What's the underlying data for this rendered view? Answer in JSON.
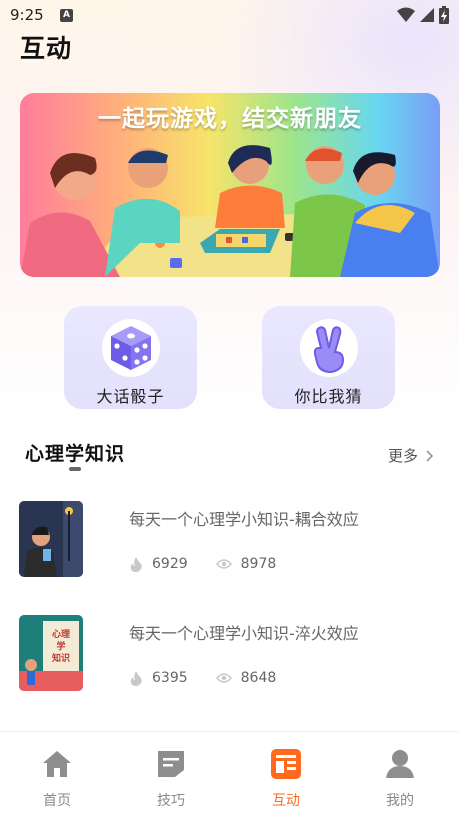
{
  "status_bar": {
    "time": "9:25",
    "notification_icon": "A"
  },
  "header": {
    "title": "互动"
  },
  "banner": {
    "title": "一起玩游戏，结交新朋友"
  },
  "games": [
    {
      "label": "大话骰子",
      "icon": "dice-icon"
    },
    {
      "label": "你比我猜",
      "icon": "victory-hand-icon"
    }
  ],
  "section": {
    "title": "心理学知识",
    "more_label": "更多"
  },
  "articles": [
    {
      "title": "每天一个心理学小知识-耦合效应",
      "likes": "6929",
      "views": "8978"
    },
    {
      "title": "每天一个心理学小知识-淬火效应",
      "likes": "6395",
      "views": "8648"
    }
  ],
  "article_thumb_text": "心理学知识",
  "bottom_nav": [
    {
      "label": "首页",
      "icon": "home-icon",
      "active": false
    },
    {
      "label": "技巧",
      "icon": "note-icon",
      "active": false
    },
    {
      "label": "互动",
      "icon": "interact-icon",
      "active": true
    },
    {
      "label": "我的",
      "icon": "user-icon",
      "active": false
    }
  ],
  "colors": {
    "accent": "#ff6a1f",
    "card_bg": "#e6e4fd",
    "dice": "#7c6cf0"
  }
}
